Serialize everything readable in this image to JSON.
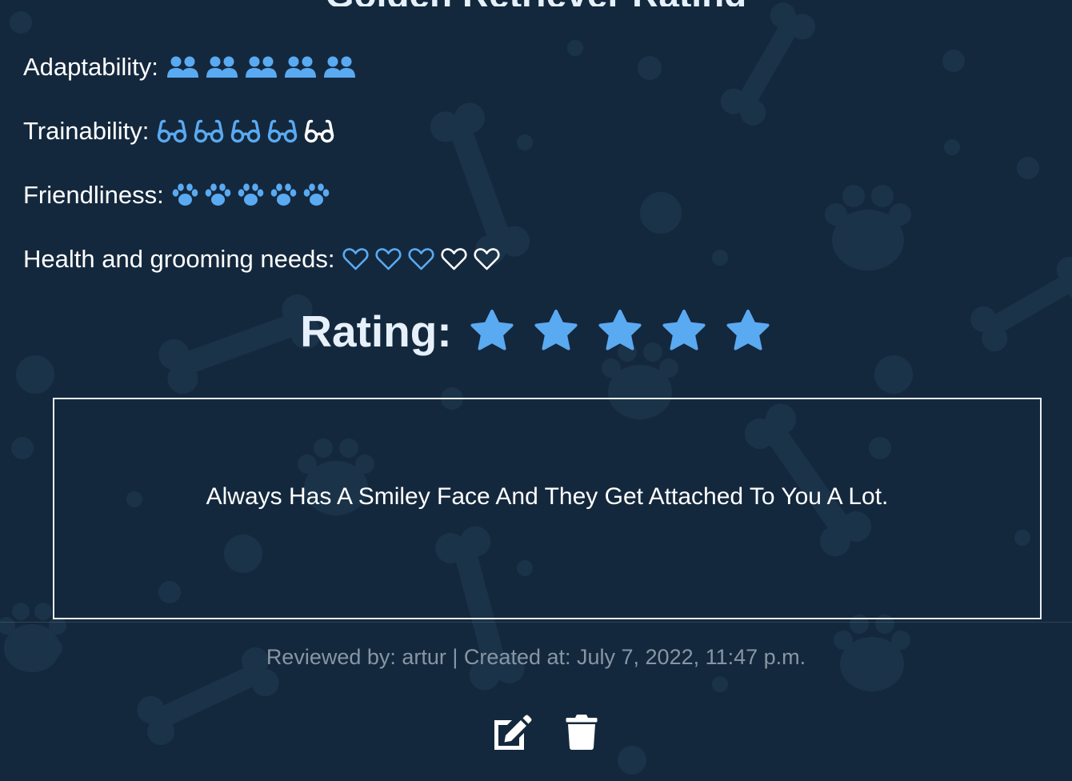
{
  "breed_title": "Golden Retriever Rating",
  "attributes": [
    {
      "label": "Adaptability:",
      "icon": "users-icon",
      "filled": 5,
      "total": 5
    },
    {
      "label": "Trainability:",
      "icon": "glasses-icon",
      "filled": 4,
      "total": 5
    },
    {
      "label": "Friendliness:",
      "icon": "paw-icon",
      "filled": 5,
      "total": 5
    },
    {
      "label": "Health and grooming needs:",
      "icon": "heart-outline-icon",
      "filled": 3,
      "total": 5
    }
  ],
  "rating": {
    "label": "Rating:",
    "value": 5,
    "max": 5
  },
  "review": {
    "text": "Always Has A Smiley Face And They Get Attached To You A Lot."
  },
  "meta": {
    "text": "Reviewed by: artur | Created at: July 7, 2022, 11:47 p.m."
  },
  "actions": [
    {
      "name": "edit-button",
      "icon": "edit-icon"
    },
    {
      "name": "delete-button",
      "icon": "trash-icon"
    }
  ],
  "colors": {
    "background": "#14283d",
    "accent": "#5aaaf2",
    "text": "#ffffff",
    "muted": "#8796a4",
    "heading": "#e6f0fa"
  }
}
